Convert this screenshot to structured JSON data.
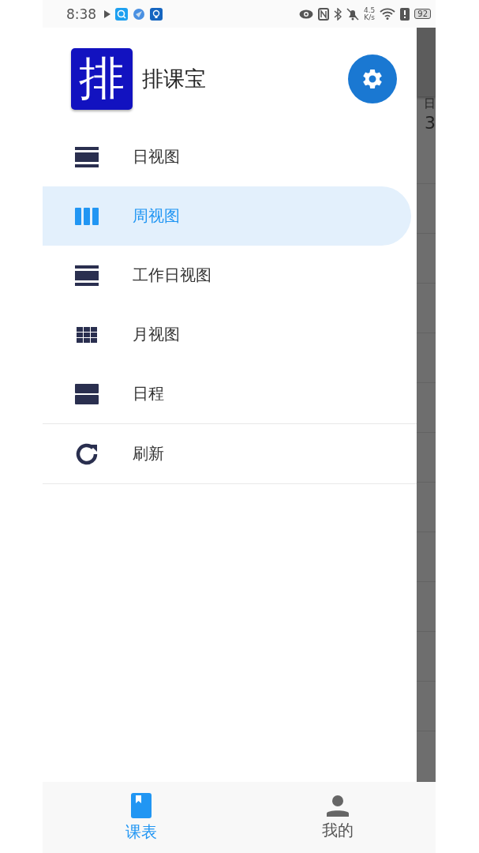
{
  "status_bar": {
    "time": "8:38",
    "net_speed": "4.5",
    "net_unit": "K/s",
    "battery": "92"
  },
  "drawer": {
    "app_name": "排课宝",
    "logo_char": "排",
    "items": [
      {
        "label": "日视图",
        "kind": "rows",
        "selected": false
      },
      {
        "label": "周视图",
        "kind": "columns",
        "selected": true
      },
      {
        "label": "工作日视图",
        "kind": "rows",
        "selected": false
      },
      {
        "label": "月视图",
        "kind": "grid",
        "selected": false
      },
      {
        "label": "日程",
        "kind": "split",
        "selected": false
      },
      {
        "label": "刷新",
        "kind": "refresh",
        "selected": false,
        "divider_before": true
      }
    ]
  },
  "background": {
    "texts": [
      "日",
      "3"
    ]
  },
  "bottom_nav": [
    {
      "label": "课表",
      "kind": "book",
      "selected": true
    },
    {
      "label": "我的",
      "kind": "person",
      "selected": false
    }
  ]
}
